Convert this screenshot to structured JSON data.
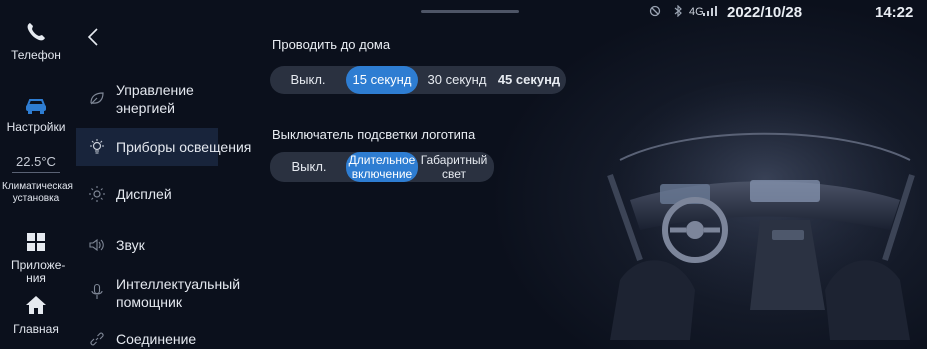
{
  "status_bar": {
    "date": "2022/10/28",
    "time": "14:22",
    "network": "4G",
    "icons": [
      "no-disturb-icon",
      "bluetooth-icon",
      "signal-icon"
    ]
  },
  "dock": {
    "phone_label": "Телефон",
    "settings_label": "Настройки",
    "temperature": "22.5°C",
    "climate_label": "Климатическая установка",
    "apps_label": "Приложе-ния",
    "home_label": "Главная"
  },
  "menu": {
    "items": [
      {
        "label": "Управление энергией",
        "icon": "leaf-icon"
      },
      {
        "label": "Приборы освещения",
        "icon": "bulb-icon"
      },
      {
        "label": "Дисплей",
        "icon": "brightness-icon"
      },
      {
        "label": "Звук",
        "icon": "speaker-icon"
      },
      {
        "label": "Интеллектуальный помощник",
        "icon": "microphone-icon"
      },
      {
        "label": "Соединение",
        "icon": "link-icon"
      }
    ],
    "active_index": 1
  },
  "content": {
    "follow_home": {
      "title": "Проводить до дома",
      "options": [
        "Выкл.",
        "15 секунд",
        "30 секунд",
        "45 секунд"
      ],
      "selected": "15 секунд"
    },
    "logo_light": {
      "title": "Выключатель подсветки логотипа",
      "options": [
        "Выкл.",
        "Длительное включение",
        "Габаритный свет"
      ],
      "selected": "Длительное включение"
    }
  },
  "colors": {
    "accent": "#2e7dd2",
    "background": "#0c1220",
    "segment_bg": "#2a3140"
  }
}
